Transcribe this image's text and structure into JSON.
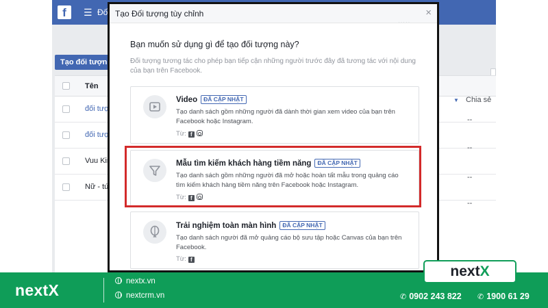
{
  "background": {
    "breadcrumb": "Đố",
    "create_button": "Tạo đối tượn",
    "table": {
      "name_header": "Tên",
      "share_header": "Chia sẻ",
      "rows": [
        "đối tượ",
        "đối tượ",
        "Vuu Kir",
        "Nữ - tứ"
      ],
      "dashes": [
        "--",
        "--",
        "--",
        "--"
      ]
    }
  },
  "modal": {
    "title": "Tạo Đối tượng tùy chỉnh",
    "close": "×",
    "question": "Bạn muốn sử dụng gì để tạo đối tượng này?",
    "description": "Đối tượng tương tác cho phép bạn tiếp cận những người trước đây đã tương tác với nội dung của bạn trên Facebook.",
    "options": [
      {
        "title": "Video",
        "badge": "ĐÃ CẬP NHẬT",
        "description": "Tạo danh sách gồm những người đã dành thời gian xem video của bạn trên Facebook hoặc Instagram.",
        "from": "Từ:",
        "icon": "play-icon"
      },
      {
        "title": "Mẫu tìm kiếm khách hàng tiềm năng",
        "badge": "ĐÃ CẬP NHẬT",
        "description": "Tạo danh sách gồm những người đã mở hoặc hoàn tất mẫu trong quảng cáo tìm kiếm khách hàng tiềm năng trên Facebook hoặc Instagram.",
        "from": "Từ:",
        "icon": "funnel-icon"
      },
      {
        "title": "Trải nghiệm toàn màn hình",
        "badge": "ĐÃ CẬP NHẬT",
        "description": "Tạo danh sách người đã mở quảng cáo bộ sưu tập hoặc Canvas của bạn trên Facebook.",
        "from": "Từ:",
        "icon": "balloon-icon"
      }
    ]
  },
  "footer": {
    "brand": "nextX",
    "links": [
      "nextx.vn",
      "nextcrm.vn"
    ],
    "phones": [
      "0902 243 822",
      "1900 61 29"
    ],
    "logo_text": "next",
    "logo_accent": "X"
  },
  "colors": {
    "facebook_blue": "#4267b2",
    "highlight_red": "#d32a2a",
    "brand_green": "#0f9d58"
  }
}
